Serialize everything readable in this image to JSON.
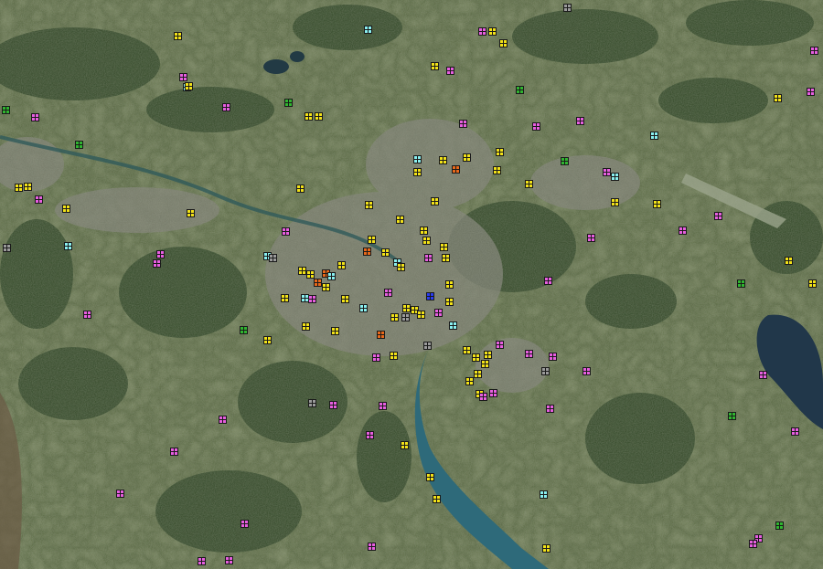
{
  "map": {
    "kind": "satellite",
    "marker_colors": {
      "yellow": "#f2e218",
      "magenta": "#e85ee0",
      "cyan": "#8af0f0",
      "green": "#2fb52f",
      "orange": "#e8681a",
      "gray": "#9a9a9a",
      "blue": "#2a3cf0",
      "mint": "#6ff0a0"
    }
  }
}
